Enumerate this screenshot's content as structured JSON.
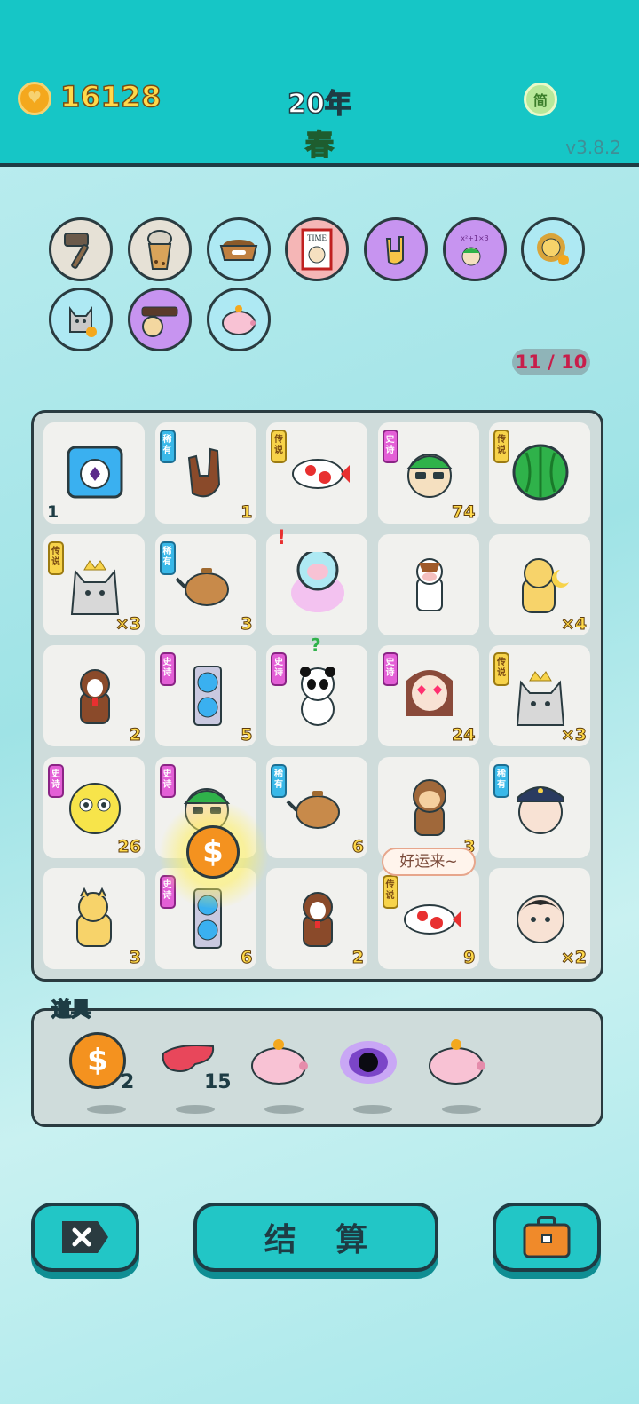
{
  "header": {
    "coins": "16128",
    "year": "20年",
    "season": "春",
    "lang": "简",
    "version": "v3.8.2"
  },
  "relics": [
    {
      "icon": "hammer-icon",
      "bg": "#e6e1d6"
    },
    {
      "icon": "bubble-tea-icon",
      "bg": "#e6e1d6"
    },
    {
      "icon": "pet-bowl-icon",
      "bg": "#aee9f3"
    },
    {
      "icon": "time-magazine-icon",
      "bg": "#f5b6b6"
    },
    {
      "icon": "rock-hand-icon",
      "bg": "#c794f0"
    },
    {
      "icon": "math-student-icon",
      "bg": "#c794f0"
    },
    {
      "icon": "lion-cat-icon",
      "bg": "#aee9f3"
    },
    {
      "icon": "husky-icon",
      "bg": "#aee9f3"
    },
    {
      "icon": "pillow-icon",
      "bg": "#c794f0"
    },
    {
      "icon": "piggy-bank-icon",
      "bg": "#aee9f3"
    }
  ],
  "counter": "11 / 10",
  "board": [
    {
      "icon": "stopwatch-icon",
      "tag": "",
      "count": "1",
      "count_pos": "left"
    },
    {
      "icon": "rock-hand-icon",
      "tag": "稀有",
      "tag_type": "rare",
      "count": "1"
    },
    {
      "icon": "koi-fish-icon",
      "tag": "传说",
      "tag_type": "legend",
      "count": ""
    },
    {
      "icon": "sunglasses-man-icon",
      "tag": "史诗",
      "tag_type": "epic",
      "count": "74"
    },
    {
      "icon": "watermelon-icon",
      "tag": "传说",
      "tag_type": "legend",
      "count": ""
    },
    {
      "icon": "king-husky-icon",
      "tag": "传说",
      "tag_type": "legend",
      "count": "×3"
    },
    {
      "icon": "teapot-icon",
      "tag": "稀有",
      "tag_type": "rare",
      "count": "3"
    },
    {
      "icon": "piggy-bowl-icon",
      "tag": "",
      "count": ""
    },
    {
      "icon": "cow-icon",
      "tag": "",
      "count": ""
    },
    {
      "icon": "moon-cat-icon",
      "tag": "",
      "count": "×4"
    },
    {
      "icon": "husky-dog-icon",
      "tag": "",
      "count": "2"
    },
    {
      "icon": "graphics-card-icon",
      "tag": "史诗",
      "tag_type": "epic",
      "count": "5"
    },
    {
      "icon": "panda-icon",
      "tag": "史诗",
      "tag_type": "epic",
      "count": ""
    },
    {
      "icon": "heart-eyes-girl-icon",
      "tag": "史诗",
      "tag_type": "epic",
      "count": "24"
    },
    {
      "icon": "king-husky-icon",
      "tag": "传说",
      "tag_type": "legend",
      "count": "×3"
    },
    {
      "icon": "yellow-chick-icon",
      "tag": "史诗",
      "tag_type": "epic",
      "count": "26"
    },
    {
      "icon": "sunglasses-man-icon",
      "tag": "史诗",
      "tag_type": "epic",
      "count": ""
    },
    {
      "icon": "teapot-icon",
      "tag": "稀有",
      "tag_type": "rare",
      "count": "6"
    },
    {
      "icon": "monkey-icon",
      "tag": "",
      "count": "3"
    },
    {
      "icon": "police-icon",
      "tag": "稀有",
      "tag_type": "rare",
      "count": ""
    },
    {
      "icon": "cat-icon",
      "tag": "",
      "count": "3"
    },
    {
      "icon": "graphics-card-icon",
      "tag": "史诗",
      "tag_type": "epic",
      "count": "6"
    },
    {
      "icon": "husky-dog-icon",
      "tag": "",
      "count": "2"
    },
    {
      "icon": "koi-fish-icon",
      "tag": "传说",
      "tag_type": "legend",
      "count": "9"
    },
    {
      "icon": "old-man-icon",
      "tag": "",
      "count": "×2"
    }
  ],
  "bubble": "好运来~",
  "items_title": "道具",
  "items": [
    {
      "icon": "dollar-coin-icon",
      "count": "2"
    },
    {
      "icon": "liver-icon",
      "count": "15"
    },
    {
      "icon": "piggy-bank-icon",
      "count": ""
    },
    {
      "icon": "black-hole-icon",
      "count": ""
    },
    {
      "icon": "piggy-bank-icon",
      "count": ""
    }
  ],
  "buttons": {
    "exit_icon": "close-icon",
    "settle_label": "结 算",
    "bag_icon": "briefcase-icon"
  }
}
